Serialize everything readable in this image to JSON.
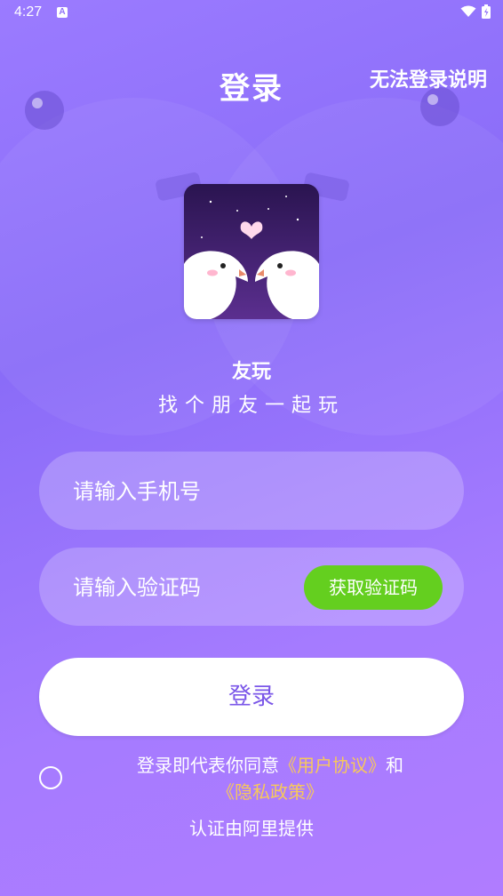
{
  "status_bar": {
    "time": "4:27",
    "notification_icon": "A"
  },
  "header": {
    "title": "登录",
    "help_link": "无法登录说明"
  },
  "app": {
    "name": "友玩",
    "slogan": "找个朋友一起玩"
  },
  "form": {
    "phone_placeholder": "请输入手机号",
    "code_placeholder": "请输入验证码",
    "get_code_label": "获取验证码",
    "login_label": "登录"
  },
  "agreement": {
    "prefix": "登录即代表你同意",
    "user_agreement": "《用户协议》",
    "and": "和",
    "privacy_policy": "《隐私政策》",
    "provider": "认证由阿里提供"
  },
  "colors": {
    "accent_green": "#64cf1f",
    "link_yellow": "#f7c85b",
    "login_text": "#7a56e8"
  }
}
